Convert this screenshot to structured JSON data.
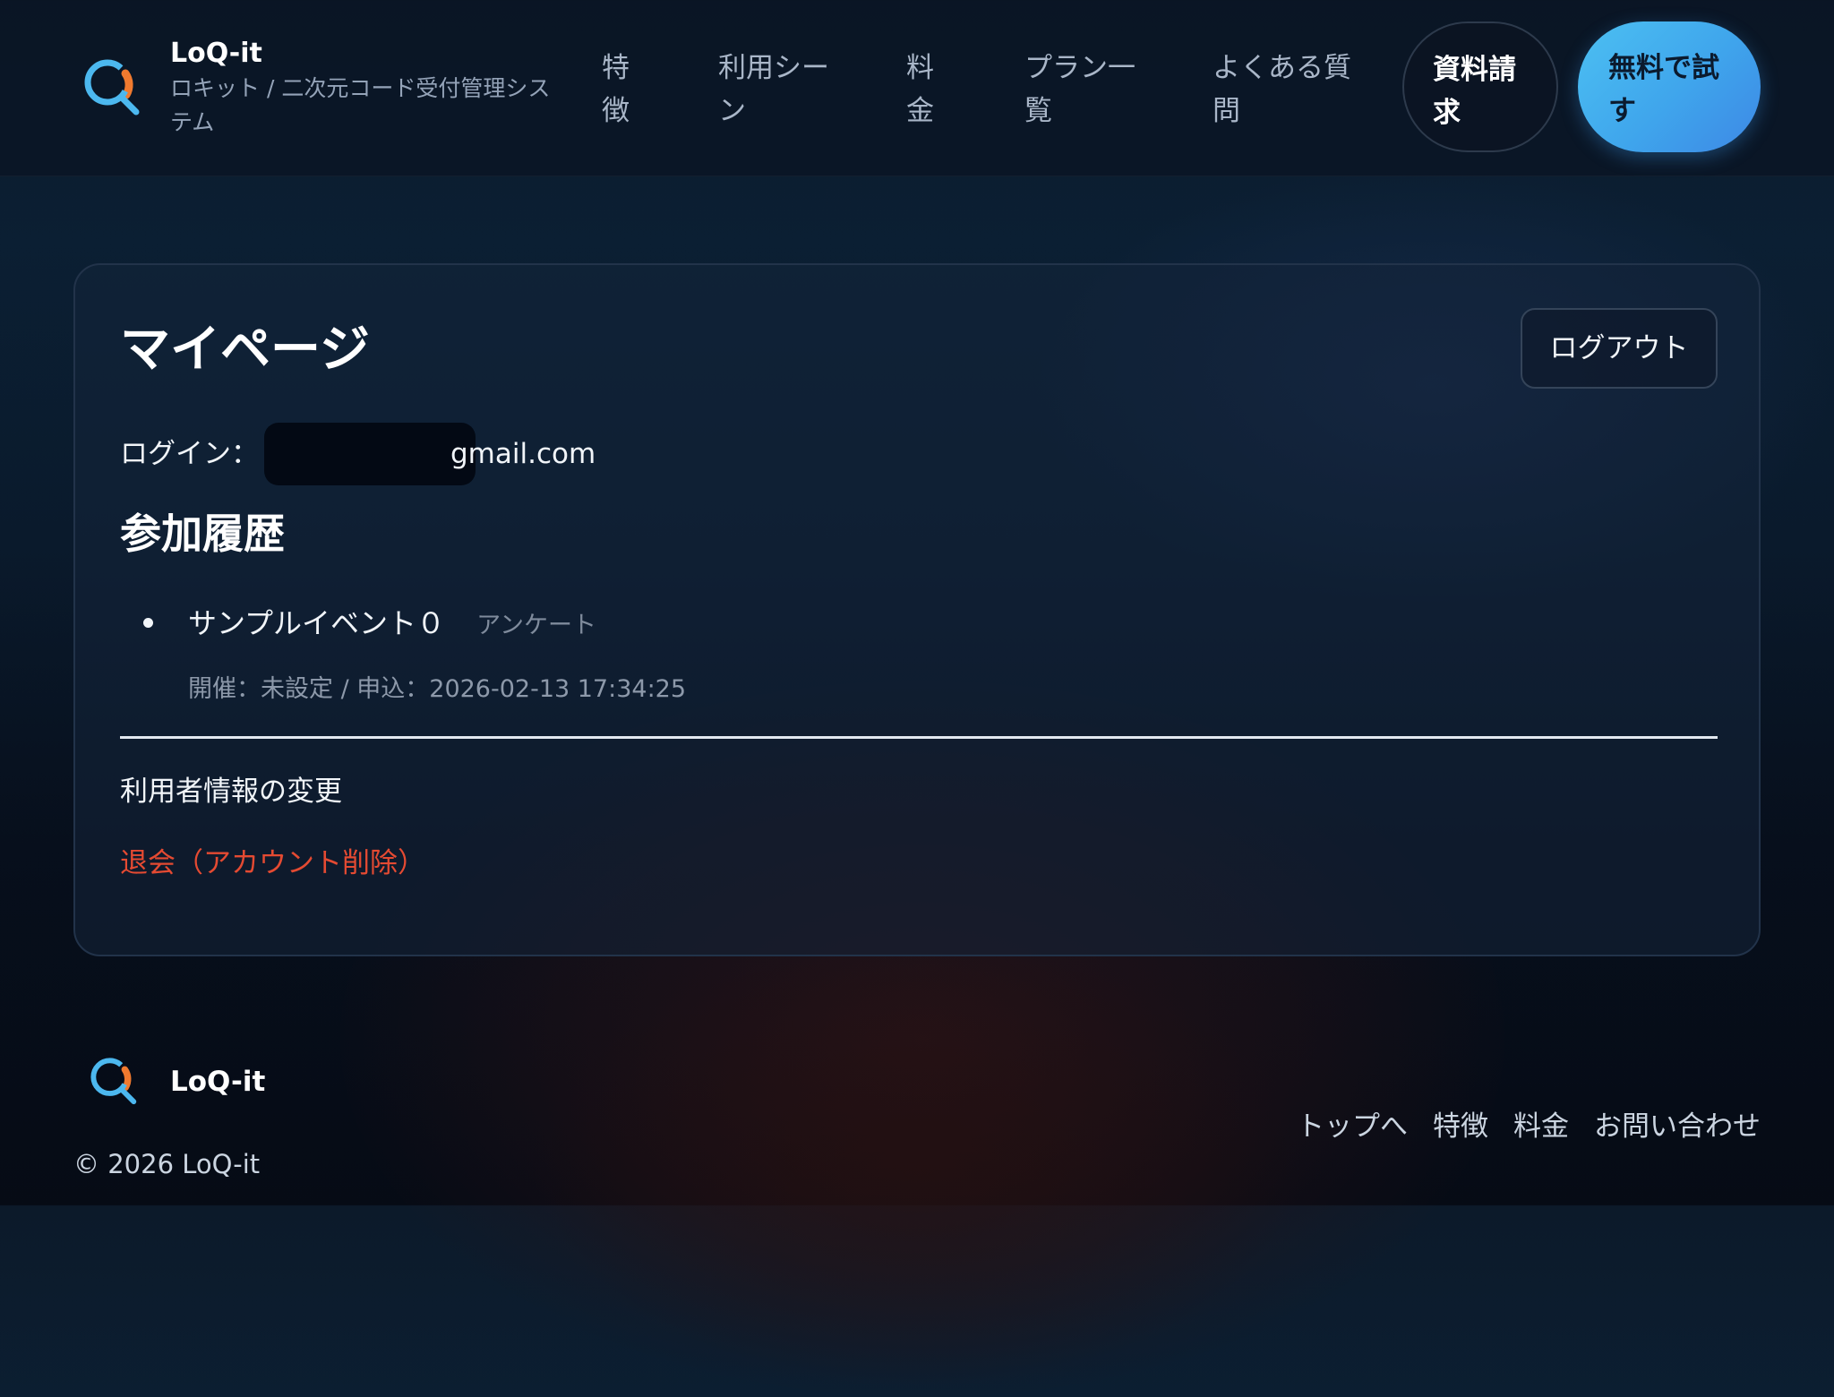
{
  "brand": {
    "name": "LoQ-it",
    "subtitle": "ロキット / 二次元コード受付管理システム"
  },
  "nav": {
    "items": [
      "特徴",
      "利用シーン",
      "料金",
      "プラン一覧",
      "よくある質問"
    ],
    "request_label": "資料請求",
    "trial_label": "無料で試す"
  },
  "mypage": {
    "title": "マイページ",
    "logout_label": "ログアウト",
    "login_label": "ログイン：",
    "login_email_suffix": "gmail.com",
    "history_title": "参加履歴",
    "history": [
      {
        "name": "サンプルイベント０",
        "tag": "アンケート",
        "meta": "開催：未設定 / 申込：2026-02-13 17:34:25"
      }
    ],
    "profile_link": "利用者情報の変更",
    "delete_link": "退会（アカウント削除）"
  },
  "footer": {
    "brand": "LoQ-it",
    "copyright": "© 2026 LoQ-it",
    "links": [
      "トップへ",
      "特徴",
      "料金",
      "お問い合わせ"
    ]
  },
  "colors": {
    "accent_blue": "#4cc0f2",
    "accent_orange": "#f07a2f",
    "danger": "#e44a32"
  }
}
